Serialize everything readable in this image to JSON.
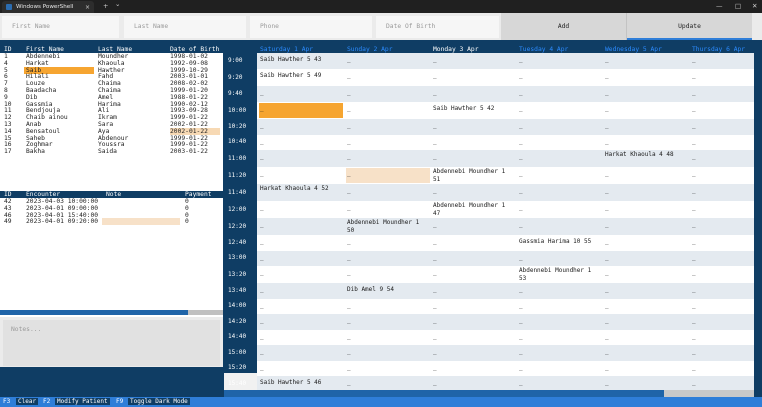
{
  "window": {
    "tab_title": "Windows PowerShell",
    "tab_close": "×",
    "new_tab": "+",
    "dropdown": "⌄",
    "minimize": "—",
    "maximize": "□",
    "close": "✕"
  },
  "inputs": {
    "first_name": "First Name",
    "last_name": "Last Name",
    "phone": "Phone",
    "dob": "Date Of Birth"
  },
  "buttons": {
    "add": "Add",
    "update": "Update"
  },
  "patients": {
    "headers": [
      "ID",
      "First Name",
      "Last Name",
      "Date of Birth"
    ],
    "rows": [
      [
        "1",
        "Abdennebi",
        "Moundher",
        "1998-01-02"
      ],
      [
        "4",
        "Harkat",
        "Khaoula",
        "1992-09-08"
      ],
      [
        "5",
        "Saib",
        "Hawther",
        "1999-10-29"
      ],
      [
        "6",
        "Hilali",
        "Fahd",
        "2003-01-01"
      ],
      [
        "7",
        "Louze",
        "Chaima",
        "2008-02-02"
      ],
      [
        "8",
        "Baadacha",
        "Chaima",
        "1999-01-20"
      ],
      [
        "9",
        "Dib",
        "Amel",
        "1988-01-22"
      ],
      [
        "10",
        "Gassmia",
        "Harima",
        "1990-02-12"
      ],
      [
        "11",
        "Bendjouja",
        "Ali",
        "1993-09-28"
      ],
      [
        "12",
        "Chaib ainou",
        "Ikram",
        "1999-01-22"
      ],
      [
        "13",
        "Anab",
        "Sara",
        "2002-01-22"
      ],
      [
        "14",
        "Bensatoul",
        "Aya",
        "2002-01-22"
      ],
      [
        "15",
        "Saheb",
        "Abdenour",
        "1999-01-22"
      ],
      [
        "16",
        "Zoghmar",
        "Youssra",
        "1999-01-22"
      ],
      [
        "17",
        "Bakha",
        "Saida",
        "2003-01-22"
      ]
    ]
  },
  "encounters": {
    "headers": [
      "ID",
      "Encounter",
      "Note",
      "Payment"
    ],
    "rows": [
      [
        "42",
        "2023-04-03 10:00:00",
        "",
        "0"
      ],
      [
        "43",
        "2023-04-01 09:00:00",
        "",
        "0"
      ],
      [
        "46",
        "2023-04-01 15:40:00",
        "",
        "0"
      ],
      [
        "49",
        "2023-04-01 09:20:00",
        "",
        "0"
      ]
    ]
  },
  "notes_placeholder": "Notes...",
  "schedule": {
    "days": [
      "Saturday 1 Apr",
      "Sunday 2 Apr",
      "Monday 3 Apr",
      "Tuesday 4 Apr",
      "Wednesday 5 Apr",
      "Thursday 6 Apr"
    ],
    "times": [
      "9:00",
      "9:20",
      "9:40",
      "10:00",
      "10:20",
      "10:40",
      "11:00",
      "11:20",
      "11:40",
      "12:00",
      "12:20",
      "12:40",
      "13:00",
      "13:20",
      "13:40",
      "14:00",
      "14:20",
      "14:40",
      "15:00",
      "15:20",
      "15:40"
    ],
    "empty": "_",
    "appointments": {
      "sat_900": "Saib Hawther 5 43",
      "sat_920": "Saib Hawther 5 49",
      "mon_1000": "Saib Hawther 5 42",
      "wed_1100": "Harkat Khaoula 4 48",
      "mon_1120": "Abdennebi Moundher 1 51",
      "sat_1140": "Harkat Khaoula 4 52",
      "mon_1200": "Abdennebi Moundher 1 47",
      "sun_1220": "Abdennebi Moundher 1 50",
      "tue_1240": "Gassmia Harima 10 55",
      "tue_1320": "Abdennebi Moundher 1 53",
      "sun_1340": "Dib Amel 9 54",
      "sat_1540": "Saib Hawther 5 46"
    }
  },
  "statusbar": {
    "k1": "F3",
    "l1": "Clear",
    "k2": "F2",
    "l2": "Modify Patient",
    "k3": "F9",
    "l3": "Toggle Dark Mode"
  }
}
